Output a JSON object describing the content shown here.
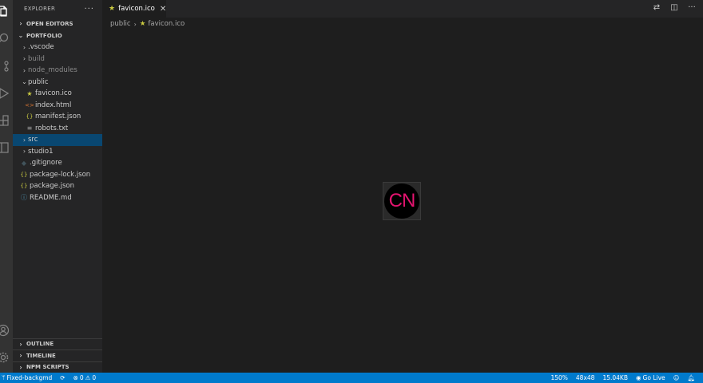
{
  "explorer": {
    "title": "EXPLORER",
    "more": "···",
    "open_editors": "OPEN EDITORS",
    "project": "PORTFOLIO",
    "tree": [
      {
        "label": ".vscode",
        "type": "folder",
        "depth": 1,
        "expanded": false,
        "dim": false
      },
      {
        "label": "build",
        "type": "folder",
        "depth": 1,
        "expanded": false,
        "dim": true
      },
      {
        "label": "node_modules",
        "type": "folder",
        "depth": 1,
        "expanded": false,
        "dim": true
      },
      {
        "label": "public",
        "type": "folder",
        "depth": 1,
        "expanded": true,
        "dim": false
      },
      {
        "label": "favicon.ico",
        "type": "file",
        "depth": 2,
        "icon": "star-icon"
      },
      {
        "label": "index.html",
        "type": "file",
        "depth": 2,
        "icon": "html-icon"
      },
      {
        "label": "manifest.json",
        "type": "file",
        "depth": 2,
        "icon": "json-icon"
      },
      {
        "label": "robots.txt",
        "type": "file",
        "depth": 2,
        "icon": "text-icon"
      },
      {
        "label": "src",
        "type": "folder",
        "depth": 1,
        "expanded": false,
        "selected": true
      },
      {
        "label": "studio1",
        "type": "folder",
        "depth": 1,
        "expanded": false
      },
      {
        "label": ".gitignore",
        "type": "file",
        "depth": 1,
        "icon": "git-icon"
      },
      {
        "label": "package-lock.json",
        "type": "file",
        "depth": 1,
        "icon": "json-icon"
      },
      {
        "label": "package.json",
        "type": "file",
        "depth": 1,
        "icon": "json-icon"
      },
      {
        "label": "README.md",
        "type": "file",
        "depth": 1,
        "icon": "info-icon"
      }
    ],
    "outline": "OUTLINE",
    "timeline": "TIMELINE",
    "npm_scripts": "NPM SCRIPTS"
  },
  "tab": {
    "label": "favicon.ico",
    "icon": "star-icon",
    "close": "✕"
  },
  "breadcrumb": {
    "folder": "public",
    "file": "favicon.ico"
  },
  "preview": {
    "logo_text": "CN"
  },
  "statusbar": {
    "branch": "Fixed-backgmd",
    "errors": "0",
    "warnings": "0",
    "zoom": "150%",
    "dimensions": "48x48",
    "size": "15.04KB",
    "golive": "Go Live"
  },
  "colors": {
    "accent": "#007acc",
    "selection": "#094771",
    "logo": "#e2146f",
    "star": "#cbcb41"
  }
}
